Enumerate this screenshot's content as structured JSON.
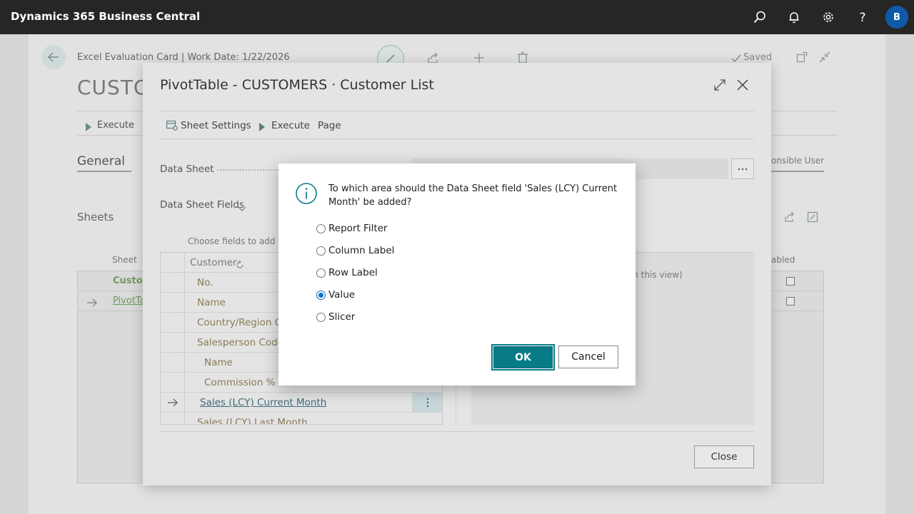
{
  "app": {
    "title": "Dynamics 365 Business Central",
    "avatar_initial": "B"
  },
  "page": {
    "breadcrumb": "Excel Evaluation Card | Work Date: 1/22/2026",
    "status": "Saved",
    "title_fragment": "CUSTO",
    "action_execute": "Execute",
    "section_general": "General",
    "section_sheets": "Sheets",
    "col_sheet": "Sheet",
    "row1_fragment": "Custon",
    "row2_fragment": "PivotTa",
    "col_responsible_fragment": "onsible User",
    "col_enabled_fragment": "abled"
  },
  "pivot": {
    "title": "PivotTable - CUSTOMERS · Customer List",
    "actions": {
      "sheet_settings": "Sheet Settings",
      "execute": "Execute",
      "page": "Page"
    },
    "data_sheet_label": "Data Sheet",
    "data_sheet_fields_label": "Data Sheet Fields",
    "choose_fields_fragment": "Choose fields to add to",
    "panel_note_fragment": "y in this view)",
    "grid_header": "Customer",
    "grid_rows": [
      {
        "label": "No."
      },
      {
        "label": "Name"
      },
      {
        "label": "Country/Region Co"
      },
      {
        "label": "Salesperson Code"
      },
      {
        "label": "Name"
      },
      {
        "label": "Commission %"
      },
      {
        "label": "Sales (LCY) Current Month"
      },
      {
        "label": "Sales (LCY) Last Month"
      }
    ],
    "close_label": "Close"
  },
  "dialog": {
    "message": "To which area should the Data Sheet field 'Sales (LCY) Current Month' be added?",
    "options": [
      {
        "label": "Report Filter",
        "selected": false
      },
      {
        "label": "Column Label",
        "selected": false
      },
      {
        "label": "Row Label",
        "selected": false
      },
      {
        "label": "Value",
        "selected": true
      },
      {
        "label": "Slicer",
        "selected": false
      }
    ],
    "ok_label": "OK",
    "cancel_label": "Cancel"
  },
  "colors": {
    "accent": "#087c86",
    "appbar": "#262626",
    "avatar": "#0f5aa8",
    "link_green": "#3e8a2e"
  },
  "icons": [
    "search-icon",
    "bell-icon",
    "gear-icon",
    "help-icon",
    "back-arrow-icon",
    "edit-icon",
    "share-icon",
    "plus-icon",
    "trash-icon",
    "checkmark-icon",
    "open-new-icon",
    "collapse-icon",
    "expand-icon",
    "close-icon",
    "info-icon",
    "more-icon",
    "refresh-icon",
    "arrow-right-icon"
  ]
}
